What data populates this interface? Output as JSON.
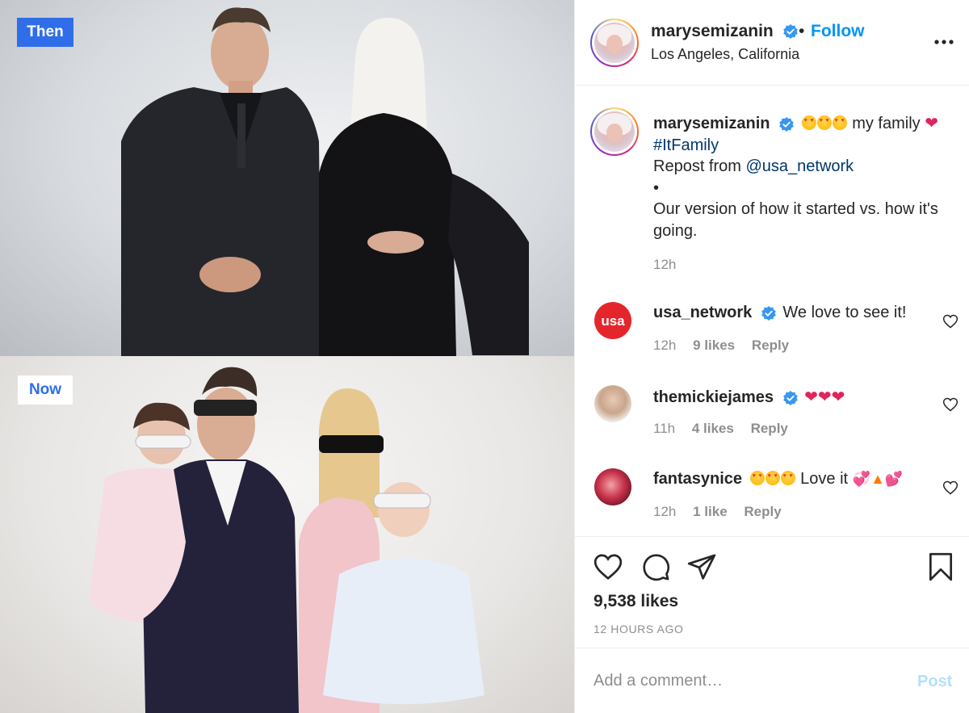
{
  "media": {
    "then_label": "Then",
    "now_label": "Now"
  },
  "header": {
    "username": "marysemizanin",
    "separator": "•",
    "follow_label": "Follow",
    "location": "Los Angeles, California"
  },
  "caption": {
    "username": "marysemizanin",
    "text_after_emojis": " my family ",
    "hashtag": "#ItFamily",
    "repost_prefix": "Repost from ",
    "repost_handle": "@usa_network",
    "bullet": "•",
    "body": "Our version of how it started vs. how it's going.",
    "time": "12h"
  },
  "comments": [
    {
      "username": "usa_network",
      "text": "We love to see it!",
      "time": "12h",
      "likes": "9 likes",
      "reply": "Reply",
      "avatar_text": "usa"
    },
    {
      "username": "themickiejames",
      "text": "",
      "time": "11h",
      "likes": "4 likes",
      "reply": "Reply"
    },
    {
      "username": "fantasynice",
      "text": " Love it ",
      "time": "12h",
      "likes": "1 like",
      "reply": "Reply"
    }
  ],
  "actions": {
    "likes_count": "9,538 likes",
    "time_ago": "12 HOURS AGO"
  },
  "add_comment": {
    "placeholder": "Add a comment…",
    "post_label": "Post"
  },
  "colors": {
    "accent": "#0095f6",
    "verified": "#3897f0",
    "link": "#00376b",
    "secondary_text": "#8e8e8e",
    "then_label_bg": "#2f6ee8",
    "usa_red": "#e4262c"
  }
}
